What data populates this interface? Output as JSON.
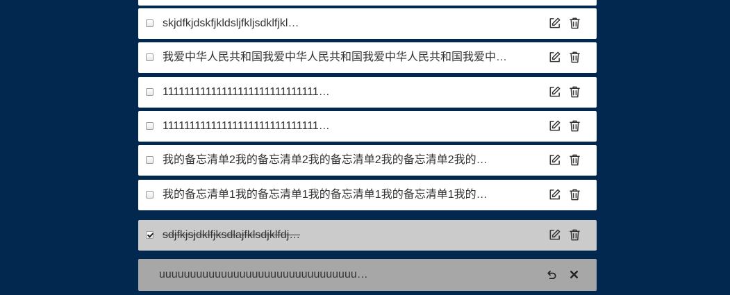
{
  "todos": [
    {
      "text": "skjdfkjdskfjkldsljfkljsdklfjkl…",
      "checked": false,
      "edit_icon": "edit-icon",
      "delete_icon": "trash-icon"
    },
    {
      "text": "我爱中华人民共和国我爱中华人民共和国我爱中华人民共和国我爱中…",
      "checked": false,
      "edit_icon": "edit-icon",
      "delete_icon": "trash-icon"
    },
    {
      "text": "11111111111111111111111111111…",
      "checked": false,
      "edit_icon": "edit-icon",
      "delete_icon": "trash-icon"
    },
    {
      "text": "11111111111111111111111111111…",
      "checked": false,
      "edit_icon": "edit-icon",
      "delete_icon": "trash-icon"
    },
    {
      "text": "我的备忘清单2我的备忘清单2我的备忘清单2我的备忘清单2我的…",
      "checked": false,
      "edit_icon": "edit-icon",
      "delete_icon": "trash-icon"
    },
    {
      "text": "我的备忘清单1我的备忘清单1我的备忘清单1我的备忘清单1我的…",
      "checked": false,
      "edit_icon": "edit-icon",
      "delete_icon": "trash-icon"
    }
  ],
  "completed": [
    {
      "text": "sdjfkjsjdklfjksdlajfklsdjklfdj…",
      "checked": true,
      "edit_icon": "edit-icon",
      "delete_icon": "trash-icon"
    }
  ],
  "trashed": [
    {
      "text": "uuuuuuuuuuuuuuuuuuuuuuuuuuuuuuuu…",
      "restore_icon": "undo-icon",
      "remove_icon": "close-icon"
    }
  ],
  "colors": {
    "background": "#03284f",
    "item": "#ffffff",
    "completed_item": "#cbcbcb",
    "trashed_item": "#a7a7a7",
    "text": "#333333"
  }
}
